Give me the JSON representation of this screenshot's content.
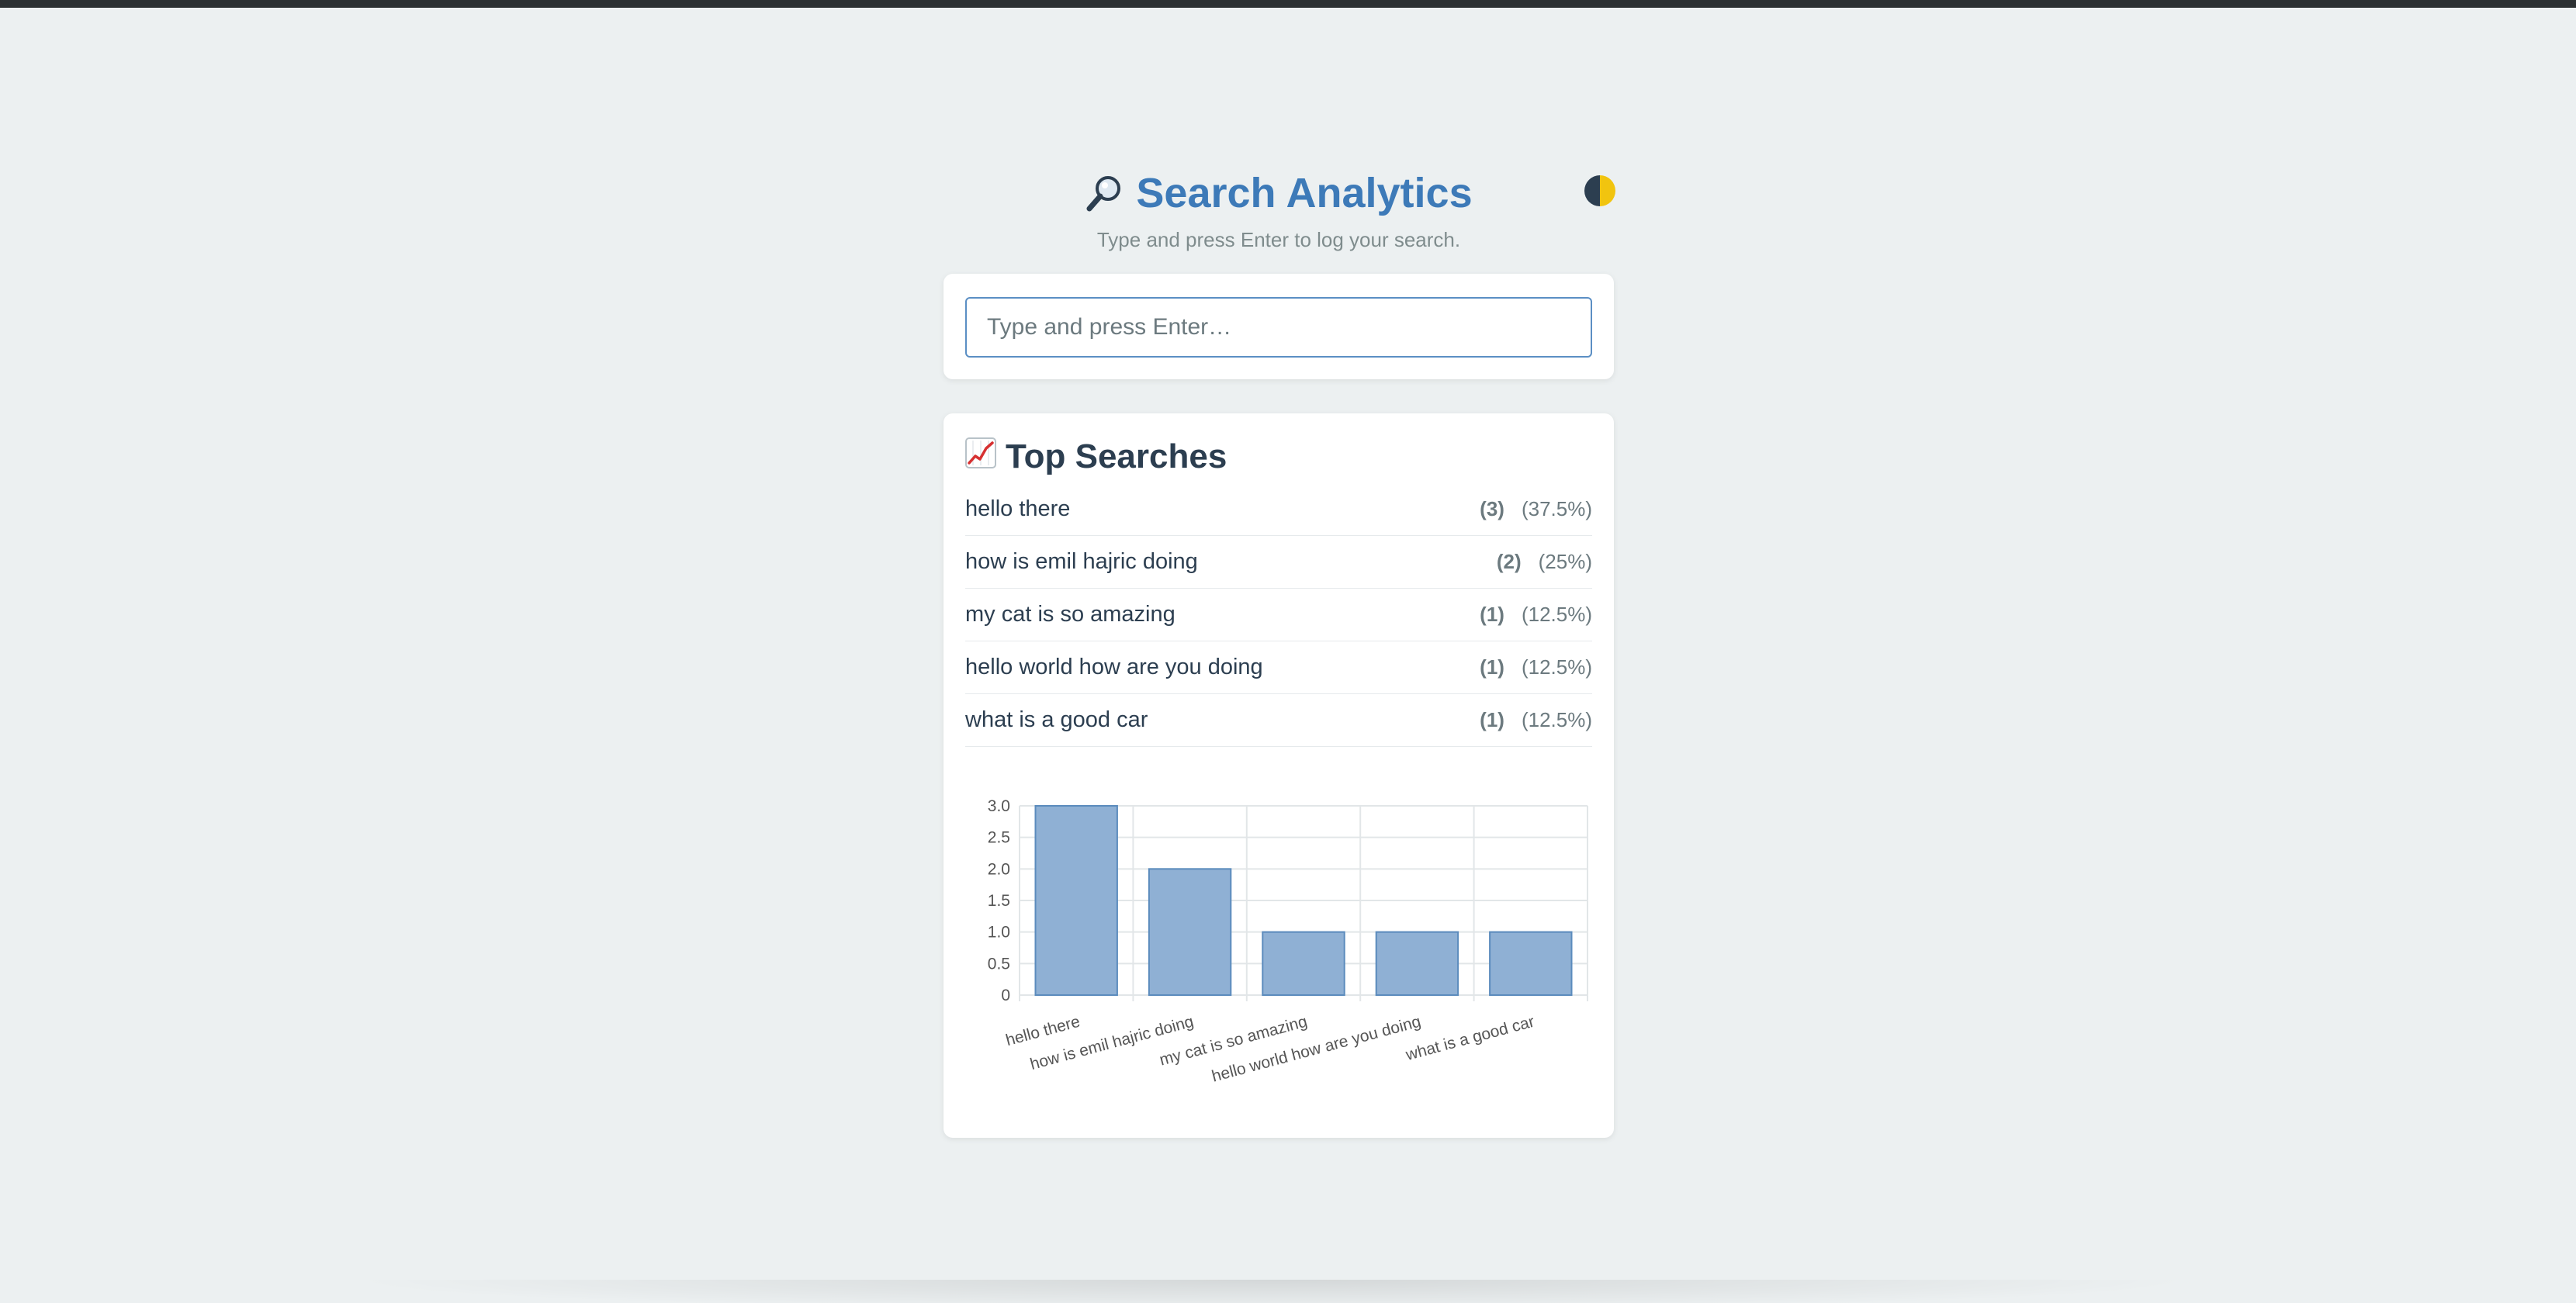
{
  "header": {
    "title": "Search Analytics",
    "subtitle": "Type and press Enter to log your search.",
    "icon": "magnifier-icon"
  },
  "theme_toggle": {
    "icon": "half-moon-icon"
  },
  "search": {
    "placeholder": "Type and press Enter…",
    "value": ""
  },
  "top_searches": {
    "title": "Top Searches",
    "icon": "chart-trend-icon",
    "items": [
      {
        "label": "hello there",
        "count": "(3)",
        "percent": "(37.5%)"
      },
      {
        "label": "how is emil hajric doing",
        "count": "(2)",
        "percent": "(25%)"
      },
      {
        "label": "my cat is so amazing",
        "count": "(1)",
        "percent": "(12.5%)"
      },
      {
        "label": "hello world how are you doing",
        "count": "(1)",
        "percent": "(12.5%)"
      },
      {
        "label": "what is a good car",
        "count": "(1)",
        "percent": "(12.5%)"
      }
    ]
  },
  "chart_data": {
    "type": "bar",
    "categories": [
      "hello there",
      "how is emil hajric doing",
      "my cat is so amazing",
      "hello world how are you doing",
      "what is a good car"
    ],
    "values": [
      3,
      2,
      1,
      1,
      1
    ],
    "ylim": [
      0,
      3
    ],
    "yticks": [
      "0",
      "0.5",
      "1.0",
      "1.5",
      "2.0",
      "2.5",
      "3.0"
    ],
    "grid": true,
    "bar_color": "#8fb0d4",
    "bar_border": "#5b8bbd",
    "grid_color": "#e2e6e8",
    "tick_color": "#555555"
  },
  "colors": {
    "accent": "#3d7ab8",
    "background": "#ecf0f1",
    "text": "#2c3e50",
    "muted": "#7f8c8d"
  }
}
